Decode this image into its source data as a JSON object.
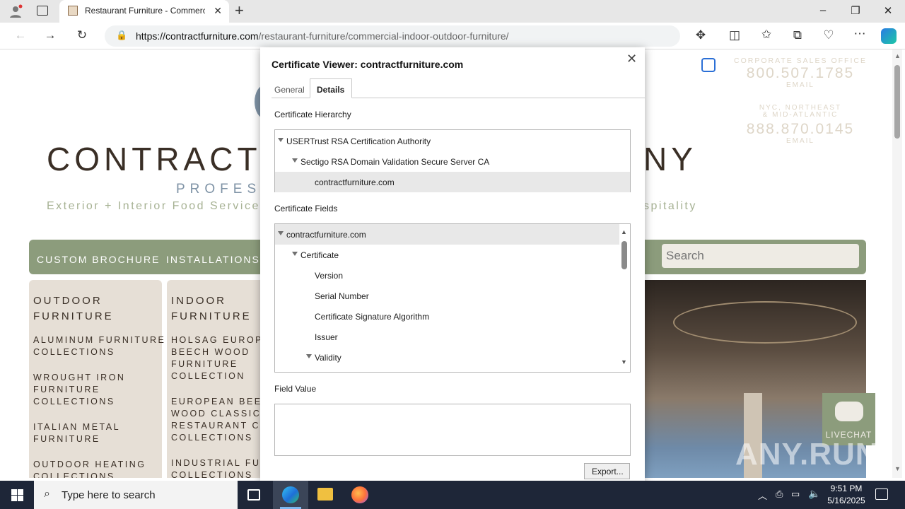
{
  "browser": {
    "tab_title": "Restaurant Furniture - Commercial",
    "new_tab": "+",
    "url_host": "https://contractfurniture.com",
    "url_path": "/restaurant-furniture/commercial-indoor-outdoor-furniture/",
    "window_controls": [
      "minimize-icon",
      "restore-icon",
      "close-icon"
    ]
  },
  "site": {
    "brand_left": "CONTRACT",
    "brand_right": "NY",
    "tagline_part": "PROFES",
    "subtitle_left": "Exterior + Interior Food Service |",
    "subtitle_right": "spitality",
    "contact": {
      "office_label": "CORPORATE SALES OFFICE",
      "office_phone": "800.507.1785",
      "office_email": "EMAIL",
      "region_label_1": "NYC, NORTHEAST",
      "region_label_2": "& MID-ATLANTIC",
      "region_phone": "888.870.0145",
      "region_email": "EMAIL"
    },
    "nav": {
      "custom_brochure": "CUSTOM BROCHURE",
      "installations": "INSTALLATIONS",
      "search_placeholder": "Search"
    },
    "outdoor": {
      "heading_1": "OUTDOOR",
      "heading_2": "FURNITURE",
      "items": [
        [
          "ALUMINUM FURNITURE",
          "COLLECTIONS"
        ],
        [
          "WROUGHT IRON",
          "FURNITURE",
          "COLLECTIONS"
        ],
        [
          "ITALIAN METAL",
          "FURNITURE"
        ],
        [
          "OUTDOOR HEATING",
          "COLLECTIONS"
        ]
      ]
    },
    "indoor": {
      "heading_1": "INDOOR",
      "heading_2": "FURNITURE",
      "items": [
        [
          "HOLSAG EUROPE",
          "BEECH WOOD",
          "FURNITURE",
          "COLLECTION"
        ],
        [
          "EUROPEAN BEEC",
          "WOOD CLASSIC",
          "RESTAURANT CH",
          "COLLECTIONS"
        ],
        [
          "INDUSTRIAL FURN",
          "COLLECTIONS"
        ]
      ]
    },
    "livechat": "LIVECHAT",
    "watermark": "ANY.RUN"
  },
  "cert": {
    "title": "Certificate Viewer: contractfurniture.com",
    "tabs": [
      "General",
      "Details"
    ],
    "active_tab": "Details",
    "hierarchy_label": "Certificate Hierarchy",
    "hierarchy": [
      {
        "label": "USERTrust RSA Certification Authority",
        "level": 0,
        "expanded": true
      },
      {
        "label": "Sectigo RSA Domain Validation Secure Server CA",
        "level": 1,
        "expanded": true
      },
      {
        "label": "contractfurniture.com",
        "level": 2,
        "selected": true
      }
    ],
    "fields_label": "Certificate Fields",
    "fields": [
      {
        "label": "contractfurniture.com",
        "level": 0,
        "expanded": true,
        "selected": true
      },
      {
        "label": "Certificate",
        "level": 1,
        "expanded": true
      },
      {
        "label": "Version",
        "level": 2
      },
      {
        "label": "Serial Number",
        "level": 2
      },
      {
        "label": "Certificate Signature Algorithm",
        "level": 2
      },
      {
        "label": "Issuer",
        "level": 2
      },
      {
        "label": "Validity",
        "level": 2,
        "expanded": true
      }
    ],
    "field_value_label": "Field Value",
    "field_value": "",
    "export_label": "Export..."
  },
  "taskbar": {
    "search_placeholder": "Type here to search",
    "time": "9:51 PM",
    "date": "5/16/2025"
  }
}
